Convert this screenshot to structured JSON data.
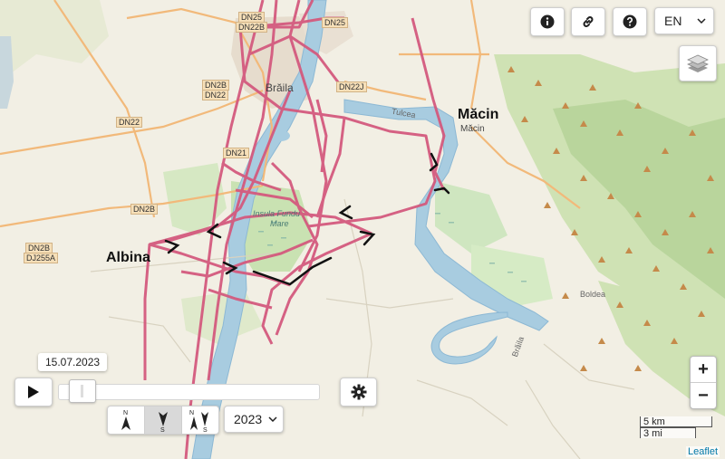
{
  "map": {
    "places": {
      "albina": "Albina",
      "macin_big": "Măcin",
      "macin_small": "Măcin",
      "braila": "Brăila",
      "insula": "Insula Fundu",
      "insula2": "Mare",
      "tulcea_road": "Tulcea",
      "boldea": "Boldea",
      "braila_river": "Brăila"
    },
    "roads": {
      "dn25_top": "DN25",
      "dn22b_top": "DN22B",
      "dn25_right": "DN25",
      "dn2b_a": "DN2B",
      "dn22_a": "DN22",
      "dn22j": "DN22J",
      "dn22_b": "DN22",
      "dn21": "DN21",
      "dn2b_b": "DN2B",
      "dn2b_c": "DN2B",
      "dj255a": "DJ255A"
    },
    "track_color": "#d45a7e"
  },
  "controls": {
    "info_icon": "info-icon",
    "link_icon": "link-icon",
    "help_icon": "help-icon",
    "language": "EN",
    "layers_icon": "layers-icon",
    "zoom_in": "+",
    "zoom_out": "−"
  },
  "timeline": {
    "date": "15.07.2023",
    "year": "2023",
    "slider_position": 0.04,
    "direction_buttons": [
      {
        "icon": "north-arrow-icon",
        "label": "N"
      },
      {
        "icon": "south-arrow-icon",
        "label": "S"
      },
      {
        "icon": "north-south-arrow-icon",
        "label": "N S"
      }
    ]
  },
  "scale": {
    "metric": "5 km",
    "imperial": "3 mi"
  },
  "attribution": "Leaflet"
}
